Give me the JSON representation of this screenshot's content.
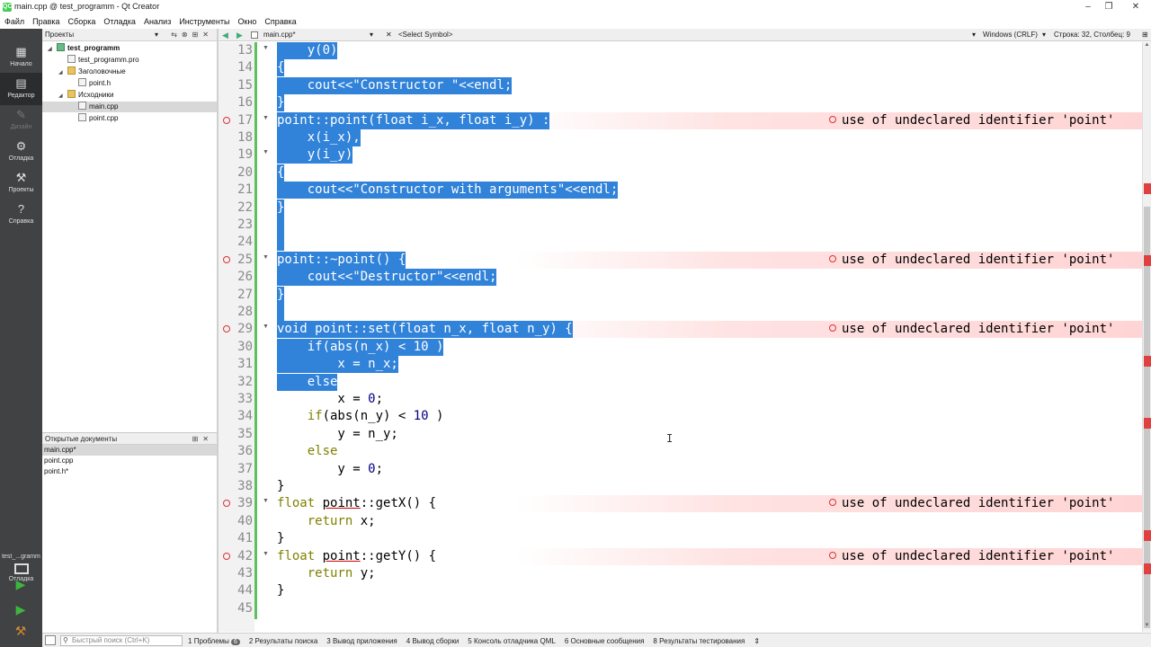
{
  "window": {
    "title": "main.cpp @ test_programm - Qt Creator",
    "app_icon": "QC"
  },
  "menu": [
    "Файл",
    "Правка",
    "Сборка",
    "Отладка",
    "Анализ",
    "Инструменты",
    "Окно",
    "Справка"
  ],
  "modes": [
    {
      "label": "Начало",
      "icon": "grid-icon"
    },
    {
      "label": "Редактор",
      "icon": "edit-icon"
    },
    {
      "label": "Дизайн",
      "icon": "pen-icon"
    },
    {
      "label": "Отладка",
      "icon": "bug-icon"
    },
    {
      "label": "Проекты",
      "icon": "wrench-icon"
    },
    {
      "label": "Справка",
      "icon": "help-icon"
    }
  ],
  "kit": {
    "name": "test_...gramm",
    "mode": "Отладка"
  },
  "projects_panel": {
    "title": "Проекты",
    "tree": [
      {
        "label": "test_programm",
        "level": 0
      },
      {
        "label": "test_programm.pro",
        "level": 1
      },
      {
        "label": "Заголовочные",
        "level": 1
      },
      {
        "label": "point.h",
        "level": 2
      },
      {
        "label": "Исходники",
        "level": 1
      },
      {
        "label": "main.cpp",
        "level": 2
      },
      {
        "label": "point.cpp",
        "level": 2
      }
    ]
  },
  "open_docs": {
    "title": "Открытые документы",
    "items": [
      "main.cpp*",
      "point.cpp",
      "point.h*"
    ]
  },
  "editor_toolbar": {
    "document": "main.cpp*",
    "symbol": "<Select Symbol>",
    "encoding": "Windows (CRLF)",
    "position": "Строка: 32, Столбец: 9"
  },
  "error_message": "use of undeclared identifier 'point'",
  "code_lines": [
    {
      "n": "13",
      "text": "    y(0)",
      "sel": true
    },
    {
      "n": "14",
      "text": "{",
      "sel": true
    },
    {
      "n": "15",
      "text": "    cout<<\"Constructor \"<<endl;",
      "sel": true
    },
    {
      "n": "16",
      "text": "}",
      "sel": true
    },
    {
      "n": "17",
      "text": "point::point(float i_x, float i_y) :",
      "sel": true,
      "err": true
    },
    {
      "n": "18",
      "text": "    x(i_x),",
      "sel": true
    },
    {
      "n": "19",
      "text": "    y(i_y)",
      "sel": true
    },
    {
      "n": "20",
      "text": "{",
      "sel": true
    },
    {
      "n": "21",
      "text": "    cout<<\"Constructor with arguments\"<<endl;",
      "sel": true
    },
    {
      "n": "22",
      "text": "}",
      "sel": true
    },
    {
      "n": "23",
      "text": " ",
      "sel": true
    },
    {
      "n": "24",
      "text": " ",
      "sel": true
    },
    {
      "n": "25",
      "text": "point::~point() {",
      "sel": true,
      "err": true
    },
    {
      "n": "26",
      "text": "    cout<<\"Destructor\"<<endl;",
      "sel": true
    },
    {
      "n": "27",
      "text": "}",
      "sel": true
    },
    {
      "n": "28",
      "text": " ",
      "sel": true
    },
    {
      "n": "29",
      "text": "void point::set(float n_x, float n_y) {",
      "sel": true,
      "err": true
    },
    {
      "n": "30",
      "text": "    if(abs(n_x) < 10 )",
      "sel": true
    },
    {
      "n": "31",
      "text": "        x = n_x;",
      "sel": true
    },
    {
      "n": "32",
      "text": "    else",
      "sel": true
    },
    {
      "n": "33",
      "text": "        x = 0;",
      "sel": false
    },
    {
      "n": "34",
      "text": "    if(abs(n_y) < 10 )",
      "sel": false
    },
    {
      "n": "35",
      "text": "        y = n_y;",
      "sel": false
    },
    {
      "n": "36",
      "text": "    else",
      "sel": false
    },
    {
      "n": "37",
      "text": "        y = 0;",
      "sel": false
    },
    {
      "n": "38",
      "text": "}",
      "sel": false
    },
    {
      "n": "39",
      "text": "float point::getX() {",
      "sel": false,
      "err": true
    },
    {
      "n": "40",
      "text": "    return x;",
      "sel": false
    },
    {
      "n": "41",
      "text": "}",
      "sel": false
    },
    {
      "n": "42",
      "text": "float point::getY() {",
      "sel": false,
      "err": true
    },
    {
      "n": "43",
      "text": "    return y;",
      "sel": false
    },
    {
      "n": "44",
      "text": "}",
      "sel": false
    },
    {
      "n": "45",
      "text": "",
      "sel": false
    }
  ],
  "statusbar": {
    "search_placeholder": "Быстрый поиск (Ctrl+K)",
    "tabs": [
      {
        "num": "1",
        "label": "Проблемы",
        "badge": "6"
      },
      {
        "num": "2",
        "label": "Результаты поиска"
      },
      {
        "num": "3",
        "label": "Вывод приложения"
      },
      {
        "num": "4",
        "label": "Вывод сборки"
      },
      {
        "num": "5",
        "label": "Консоль отладчика QML"
      },
      {
        "num": "6",
        "label": "Основные сообщения"
      },
      {
        "num": "8",
        "label": "Результаты тестирования"
      }
    ]
  }
}
